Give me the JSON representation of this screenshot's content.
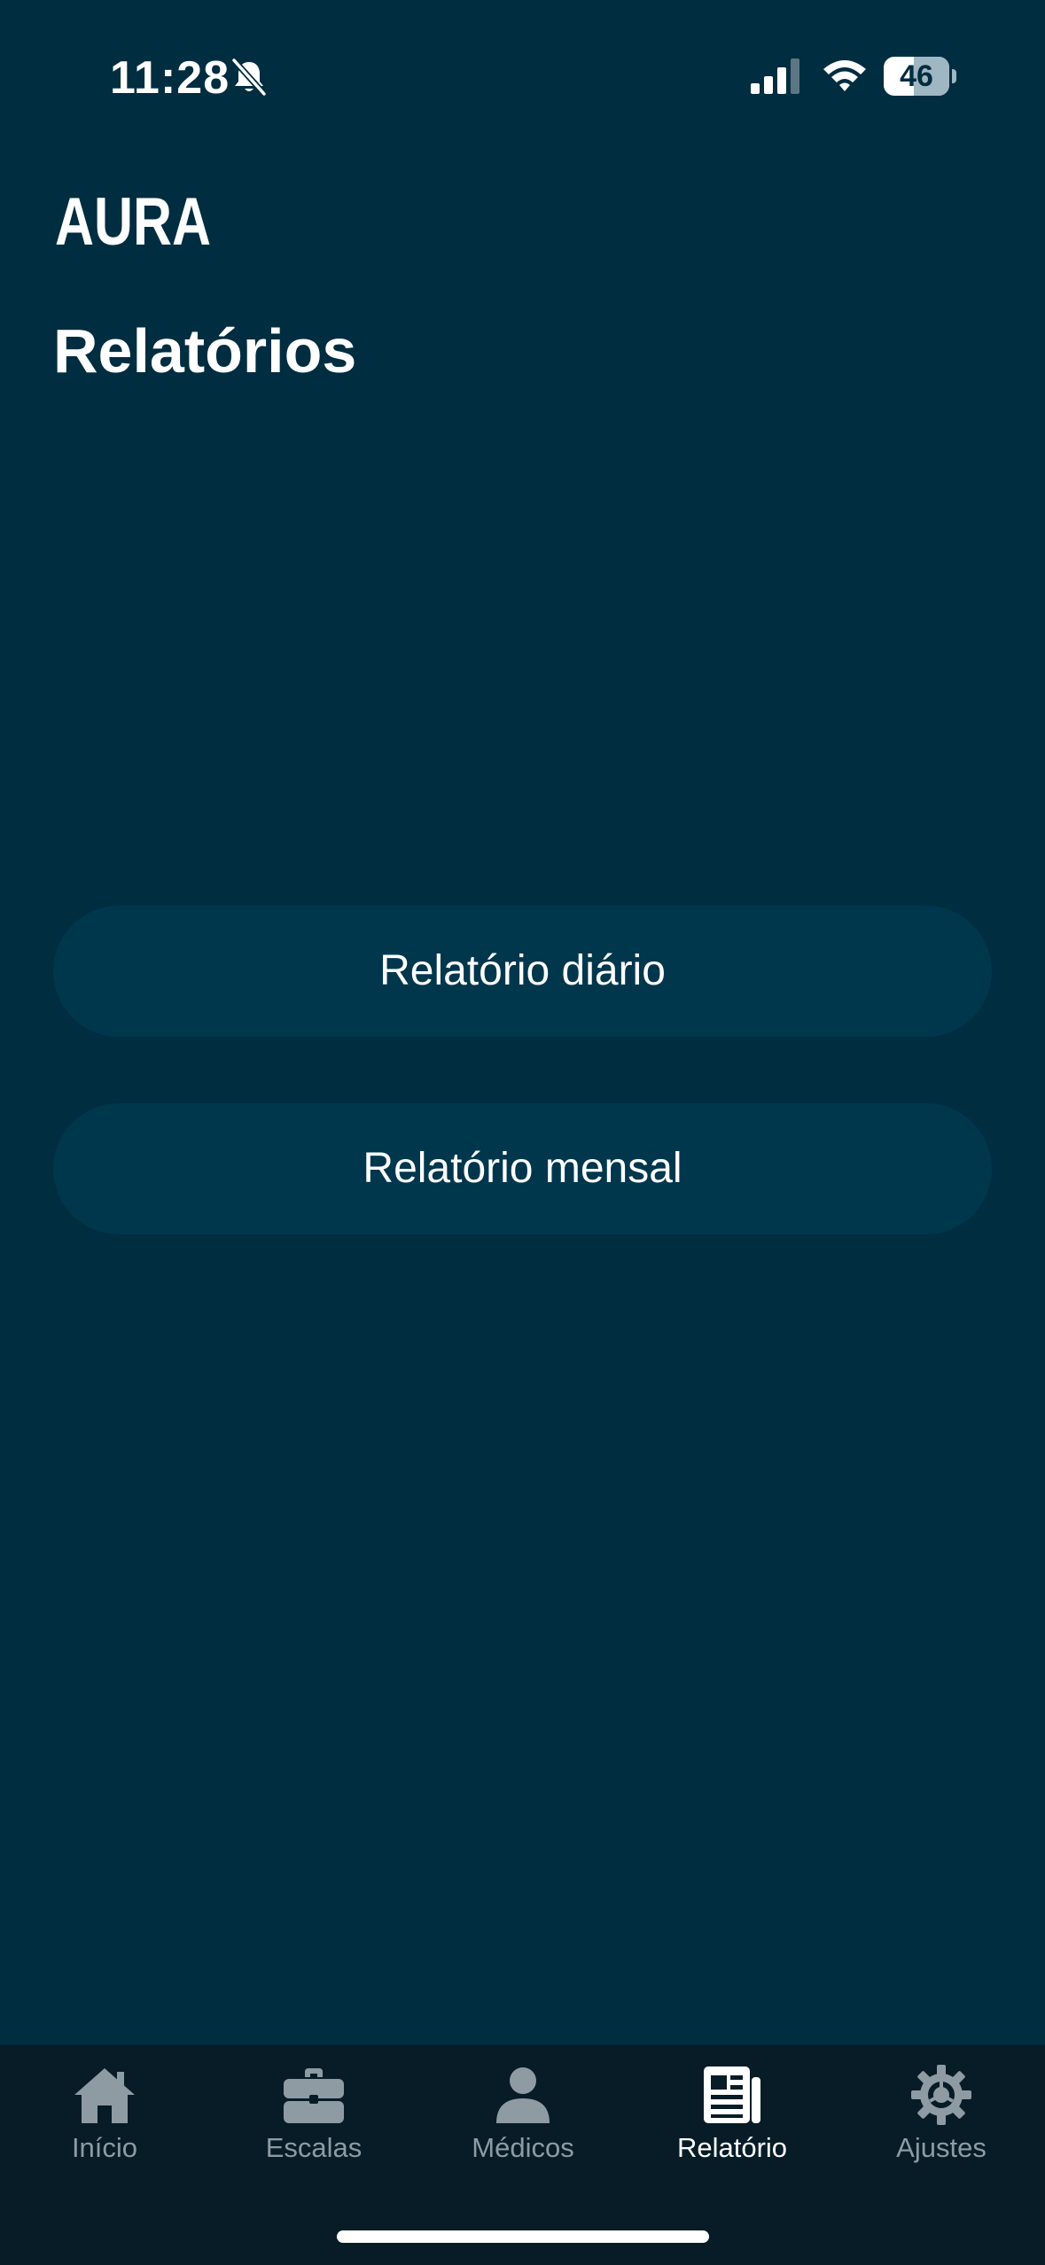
{
  "status_bar": {
    "time": "11:28",
    "battery_level": "46",
    "battery_fraction": 0.46
  },
  "header": {
    "logo_text": "AURA",
    "title": "Relatórios"
  },
  "actions": {
    "daily_label": "Relatório diário",
    "monthly_label": "Relatório mensal"
  },
  "tab_bar": {
    "items": [
      {
        "label": "Início",
        "icon": "home-icon"
      },
      {
        "label": "Escalas",
        "icon": "briefcase-icon"
      },
      {
        "label": "Médicos",
        "icon": "person-icon"
      },
      {
        "label": "Relatório",
        "icon": "newspaper-icon",
        "active": true
      },
      {
        "label": "Ajustes",
        "icon": "gear-icon"
      }
    ]
  },
  "colors": {
    "background": "#002d40",
    "button": "#00374d",
    "tab_bar": "#071c27",
    "tab_inactive": "#8e9ba3",
    "tab_active": "#ffffff"
  }
}
